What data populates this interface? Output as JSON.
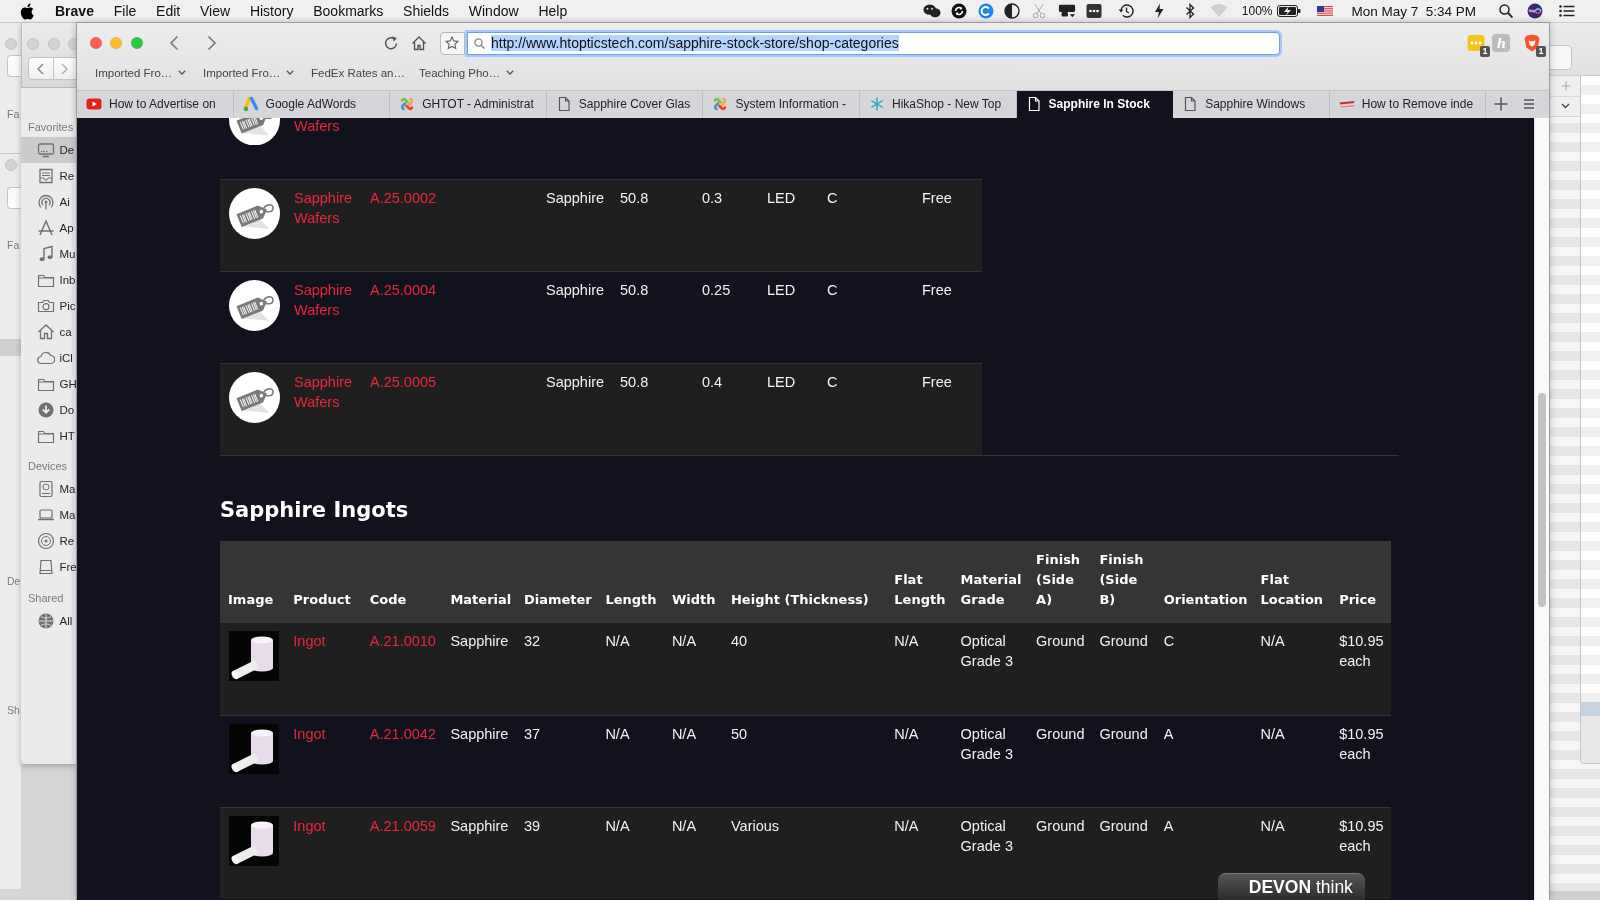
{
  "menu_bar": {
    "app": "Brave",
    "menus": [
      "File",
      "Edit",
      "View",
      "History",
      "Bookmarks",
      "Shields",
      "Window",
      "Help"
    ],
    "battery": "100%",
    "clock": "Mon May 7  5:34 PM"
  },
  "back_window": {
    "labels": [
      "Fa",
      "Fa",
      "De",
      "Sh"
    ]
  },
  "finder_sidebar": {
    "sections": [
      {
        "title": "Favorites",
        "items": [
          {
            "label": "De",
            "kind": "display",
            "selected": true
          },
          {
            "label": "Re",
            "kind": "tray",
            "selected": false
          },
          {
            "label": "Ai",
            "kind": "airdrop",
            "selected": false
          },
          {
            "label": "Ap",
            "kind": "apps",
            "selected": false
          },
          {
            "label": "Mu",
            "kind": "music",
            "selected": false
          },
          {
            "label": "Inb",
            "kind": "folder",
            "selected": false
          },
          {
            "label": "Pic",
            "kind": "camera",
            "selected": false
          },
          {
            "label": "ca",
            "kind": "home",
            "selected": false
          },
          {
            "label": "iCl",
            "kind": "cloud",
            "selected": false
          },
          {
            "label": "GH",
            "kind": "folder",
            "selected": false
          },
          {
            "label": "Do",
            "kind": "download",
            "selected": false
          },
          {
            "label": "HT",
            "kind": "folder",
            "selected": false
          }
        ]
      },
      {
        "title": "Devices",
        "items": [
          {
            "label": "Ma",
            "kind": "disk",
            "selected": false
          },
          {
            "label": "Ma",
            "kind": "laptop",
            "selected": false
          },
          {
            "label": "Re",
            "kind": "disc",
            "selected": false
          },
          {
            "label": "Fre",
            "kind": "drive",
            "selected": false
          }
        ]
      },
      {
        "title": "Shared",
        "items": [
          {
            "label": "All",
            "kind": "globe",
            "selected": false
          }
        ]
      }
    ]
  },
  "browser": {
    "url": "http://www.htopticstech.com/sapphire-stock-store/shop-categories",
    "url_selected": true,
    "extensions": [
      {
        "kind": "dots",
        "badge": "1"
      },
      {
        "kind": "letter",
        "glyph": "h"
      },
      {
        "kind": "shield",
        "badge": "1"
      }
    ],
    "bookmarks": [
      {
        "label": "Imported Fro…",
        "folder": true
      },
      {
        "label": "Imported Fro…",
        "folder": true
      },
      {
        "label": "FedEx Rates an…",
        "folder": false
      },
      {
        "label": "Teaching Pho…",
        "folder": true
      }
    ],
    "tabs": [
      {
        "title": "How to Advertise on",
        "kind": "play",
        "selected": false
      },
      {
        "title": "Google AdWords",
        "kind": "triangle",
        "selected": false
      },
      {
        "title": "GHTOT - Administrat",
        "kind": "pinwheel",
        "selected": false
      },
      {
        "title": "Sapphire Cover Glas",
        "kind": "page",
        "selected": false
      },
      {
        "title": "System Information -",
        "kind": "pinwheel",
        "selected": false
      },
      {
        "title": "HikaShop - New Top",
        "kind": "asterisk",
        "selected": false
      },
      {
        "title": "Sapphire In Stock",
        "kind": "page",
        "selected": true
      },
      {
        "title": "Sapphire Windows",
        "kind": "page",
        "selected": false
      },
      {
        "title": "How to Remove inde",
        "kind": "swoosh",
        "selected": false
      }
    ]
  },
  "page": {
    "wafer_rows": [
      {
        "cells": [
          "Wafers"
        ]
      },
      {
        "cells": [
          "Sapphire Wafers",
          "A.25.0002",
          "Sapphire",
          "50.8",
          "0.3",
          "LED",
          "C",
          "Free"
        ]
      },
      {
        "cells": [
          "Sapphire Wafers",
          "A.25.0004",
          "Sapphire",
          "50.8",
          "0.25",
          "LED",
          "C",
          "Free"
        ]
      },
      {
        "cells": [
          "Sapphire Wafers",
          "A.25.0005",
          "Sapphire",
          "50.8",
          "0.4",
          "LED",
          "C",
          "Free"
        ]
      }
    ],
    "ingots": {
      "title": "Sapphire Ingots",
      "columns": [
        "Image",
        "Product",
        "Code",
        "Material",
        "Diameter",
        "Length",
        "Width",
        "Height (Thickness)",
        "Flat Length",
        "Material Grade",
        "Finish (Side A)",
        "Finish (Side B)",
        "Orientation",
        "Flat Location",
        "Price"
      ],
      "rows": [
        {
          "cells": [
            "",
            "Ingot",
            "A.21.0010",
            "Sapphire",
            "32",
            "N/A",
            "N/A",
            "40",
            "N/A",
            "Optical Grade 3",
            "Ground",
            "Ground",
            "C",
            "N/A",
            "$10.95 each"
          ]
        },
        {
          "cells": [
            "",
            "Ingot",
            "A.21.0042",
            "Sapphire",
            "37",
            "N/A",
            "N/A",
            "50",
            "N/A",
            "Optical Grade 3",
            "Ground",
            "Ground",
            "A",
            "N/A",
            "$10.95 each"
          ]
        },
        {
          "cells": [
            "",
            "Ingot",
            "A.21.0059",
            "Sapphire",
            "39",
            "N/A",
            "N/A",
            "Various",
            "N/A",
            "Optical Grade 3",
            "Ground",
            "Ground",
            "A",
            "N/A",
            "$10.95 each"
          ]
        }
      ]
    }
  },
  "devonthink_tab": {
    "label": "**DEVON** think"
  }
}
